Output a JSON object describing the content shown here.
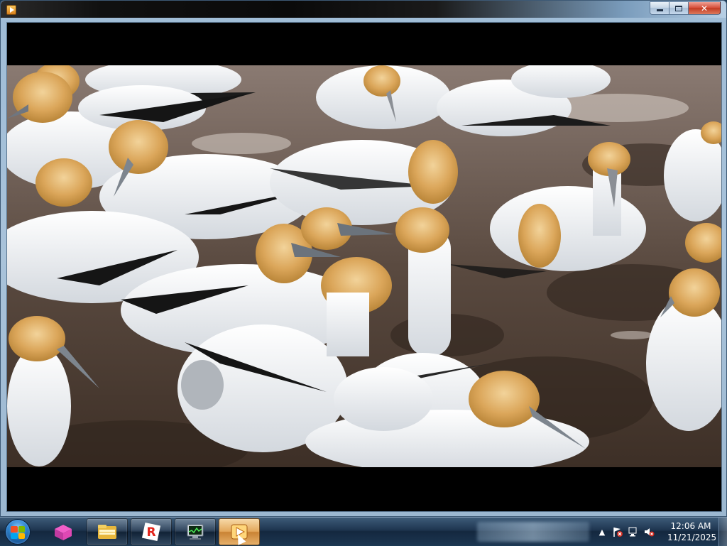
{
  "window": {
    "title": "",
    "app_icon": "media-player-icon",
    "caption_buttons": {
      "minimize": "minimize-icon",
      "maximize": "maximize-icon",
      "close_label": "✕"
    }
  },
  "video": {
    "content": "frame-of-gannet-colony-on-ground"
  },
  "taskbar": {
    "start": "windows-start-orb-icon",
    "pinned": [
      {
        "name": "pink-box-app-icon"
      },
      {
        "name": "file-explorer-icon"
      },
      {
        "name": "roblox-icon"
      },
      {
        "name": "system-monitor-icon"
      },
      {
        "name": "media-player-icon",
        "active": true
      }
    ],
    "tray": {
      "icons": [
        "show-hidden-icons-chevron",
        "action-center-flag-icon",
        "network-icon",
        "volume-muted-icon"
      ],
      "time": "12:06 AM",
      "date": "11/21/2025"
    }
  },
  "colors": {
    "titlebar_dark": "#0a0a0a",
    "frame": "#a9c3da",
    "taskbar": "#1e3550",
    "active_button": "#e3a85c",
    "close_button": "#c23b22"
  }
}
